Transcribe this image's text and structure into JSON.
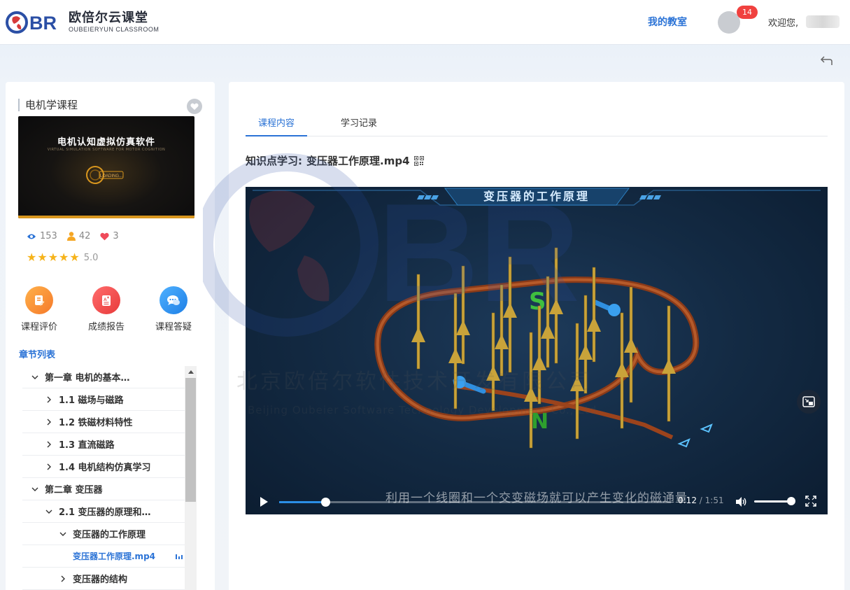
{
  "header": {
    "logo_mark": "BR",
    "logo_cn": "欧倍尔云课堂",
    "logo_en": "OUBEIERYUN CLASSROOM",
    "nav_classroom": "我的教室",
    "notification_count": "14",
    "welcome": "欢迎您,"
  },
  "course": {
    "title": "电机学课程",
    "thumbnail_title": "电机认知虚拟仿真软件",
    "thumbnail_subtitle": "VIRTUAL SIMULATION SOFTWARE FOR MOTOR COGNITION",
    "thumbnail_loading": "LOADING...",
    "views": "153",
    "learners": "42",
    "likes": "3",
    "rating": "5.0",
    "rating_stars": 5
  },
  "actions": [
    {
      "label": "课程评价",
      "icon": "edit-note-icon",
      "color": "#f58a2a"
    },
    {
      "label": "成绩报告",
      "icon": "report-icon",
      "color": "#ef4a4a"
    },
    {
      "label": "课程答疑",
      "icon": "chat-icon",
      "color": "#2a8ef0"
    }
  ],
  "chapter_heading": "章节列表",
  "chapters": [
    {
      "label": "第一章 电机的基本…",
      "level": 0,
      "expanded": true,
      "active": false
    },
    {
      "label": "1.1 磁场与磁路",
      "level": 1,
      "expanded": false,
      "active": false
    },
    {
      "label": "1.2 铁磁材料特性",
      "level": 1,
      "expanded": false,
      "active": false
    },
    {
      "label": "1.3 直流磁路",
      "level": 1,
      "expanded": false,
      "active": false
    },
    {
      "label": "1.4 电机结构仿真学习",
      "level": 1,
      "expanded": false,
      "active": false
    },
    {
      "label": "第二章 变压器",
      "level": 0,
      "expanded": true,
      "active": false
    },
    {
      "label": "2.1 变压器的原理和…",
      "level": 1,
      "expanded": true,
      "active": false
    },
    {
      "label": "变压器的工作原理",
      "level": 2,
      "expanded": true,
      "active": false
    },
    {
      "label": "变压器工作原理.mp4",
      "level": 3,
      "expanded": false,
      "active": true
    },
    {
      "label": "变压器的结构",
      "level": 2,
      "expanded": false,
      "active": false
    }
  ],
  "tabs": [
    {
      "label": "课程内容",
      "active": true
    },
    {
      "label": "学习记录",
      "active": false
    }
  ],
  "lesson": {
    "prefix": "知识点学习:",
    "name": "变压器工作原理.mp4"
  },
  "video": {
    "banner_title": "变压器的工作原理",
    "pole_s": "S",
    "pole_n": "N",
    "subtitle": "利用一个线圈和一个交变磁场就可以产生变化的磁通量",
    "current_time": "0:12",
    "duration": "/ 1:51",
    "progress": 0.117,
    "volume": 0.9,
    "accent_color": "#2b8ee6"
  },
  "watermark": {
    "line1": "北京欧倍尔软件技术开发有限公司",
    "line2": "Beijing Oubeier Software Technology Development Co., Ltd."
  }
}
